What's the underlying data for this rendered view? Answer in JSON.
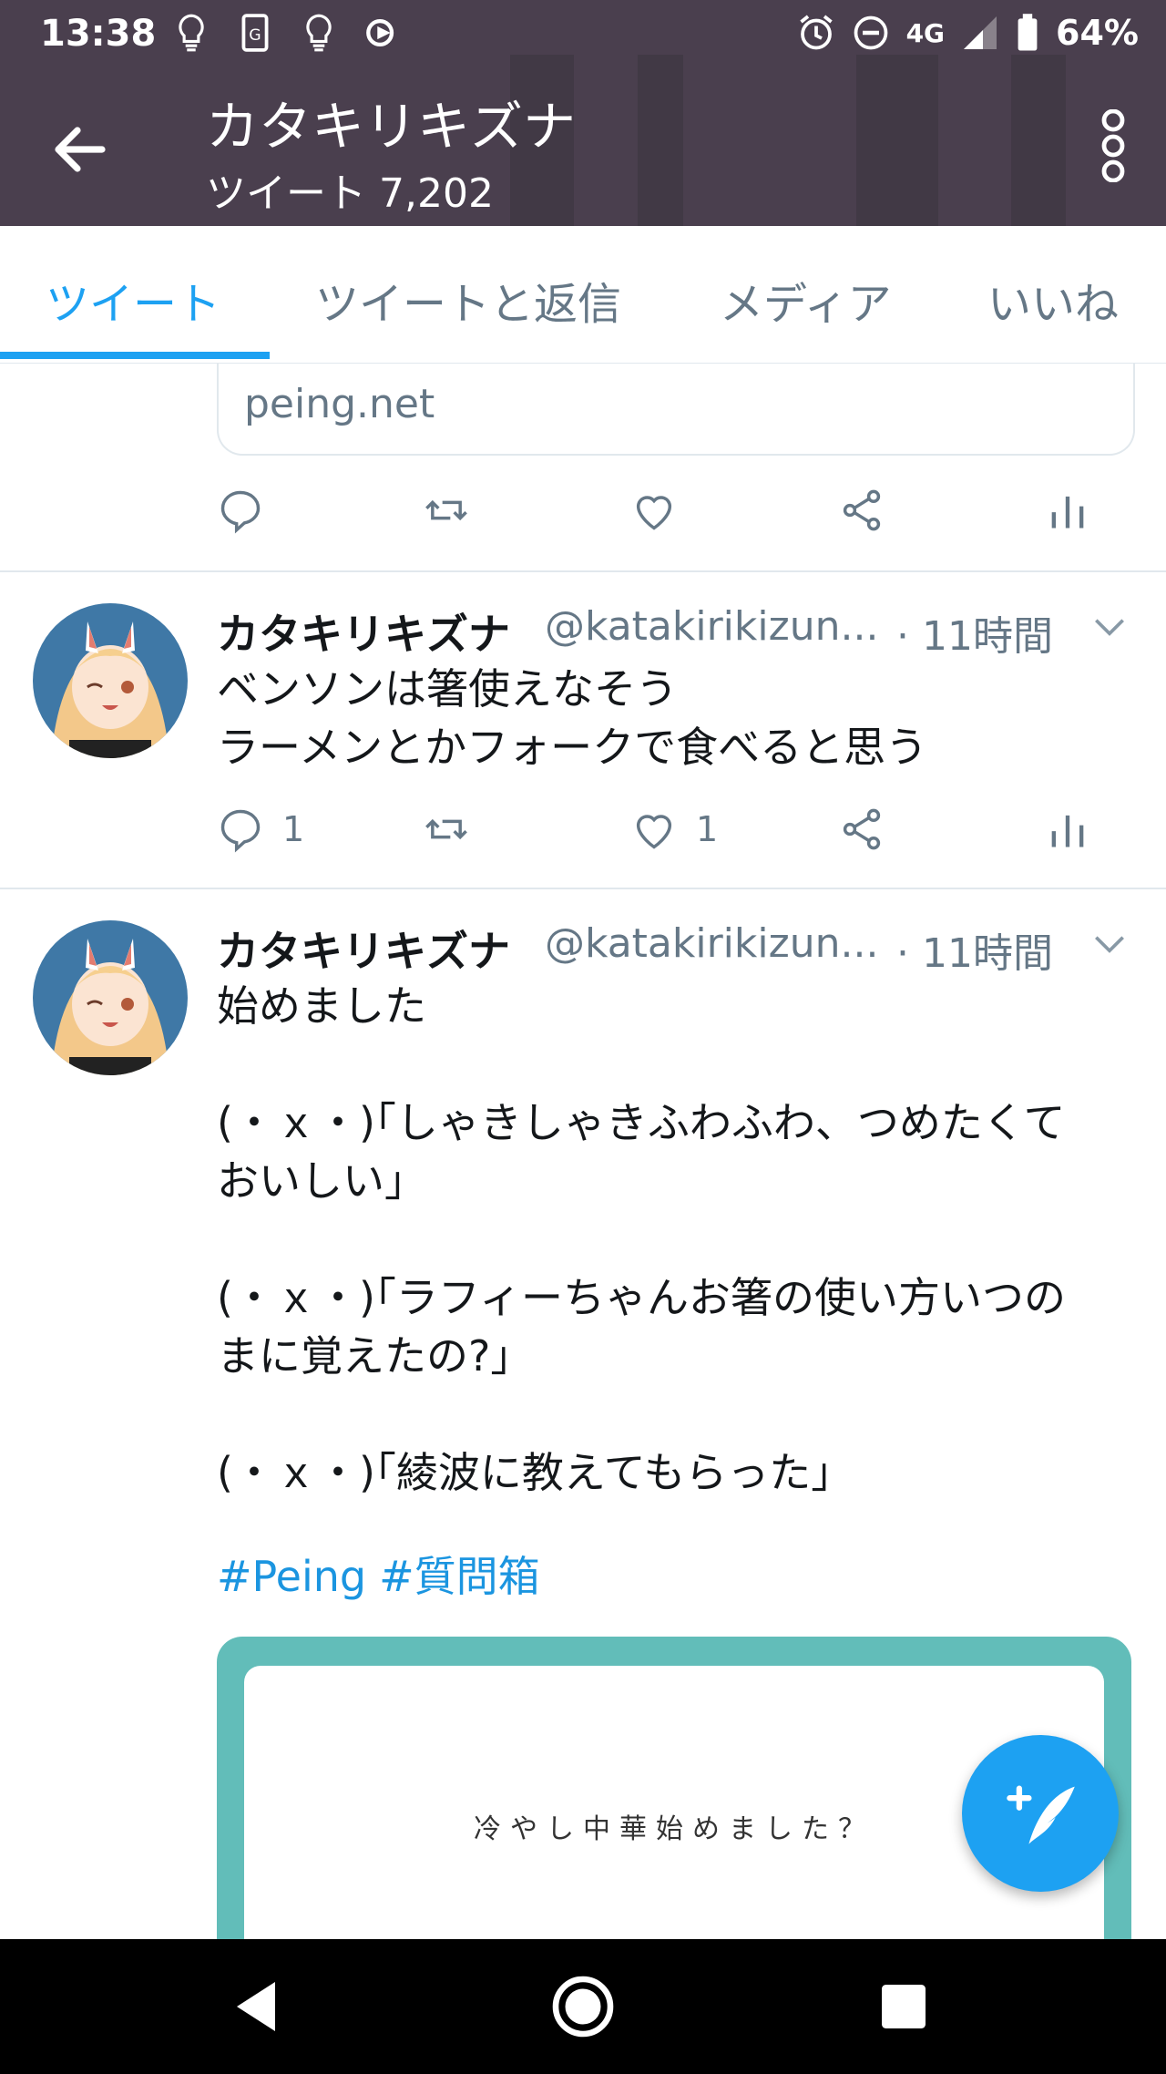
{
  "status_bar": {
    "time": "13:38",
    "network": "4G",
    "battery": "64%"
  },
  "header": {
    "title": "カタキリキズナ",
    "subtitle": "ツイート 7,202"
  },
  "tabs": [
    {
      "label": "ツイート",
      "active": true
    },
    {
      "label": "ツイートと返信",
      "active": false
    },
    {
      "label": "メディア",
      "active": false
    },
    {
      "label": "いいね",
      "active": false
    }
  ],
  "prev_tweet": {
    "link_domain": "peing.net"
  },
  "tweets": [
    {
      "name": "カタキリキズナ",
      "handle": "@katakirikizun...",
      "time": "· 11時間",
      "text": "ベンソンは箸使えなそう\nラーメンとかフォークで食べると思う",
      "reply_count": "1",
      "like_count": "1"
    },
    {
      "name": "カタキリキズナ",
      "handle": "@katakirikizun...",
      "time": "· 11時間",
      "text": "始めました\n\n(・ｘ・)｢しゃきしゃきふわふわ、つめたくて\nおいしい｣\n\n(・ｘ・)｢ラフィーちゃんお箸の使い方いつの\nまに覚えたの?｣\n\n(・ｘ・)｢綾波に教えてもらった｣",
      "hashtags": [
        "#Peing",
        "#質問箱"
      ],
      "card_question": "冷やし中華始めました？"
    }
  ],
  "colors": {
    "accent": "#1da1f2",
    "header_bg": "#4a3f4e",
    "card_teal": "#62bdb9",
    "muted": "#657786"
  }
}
